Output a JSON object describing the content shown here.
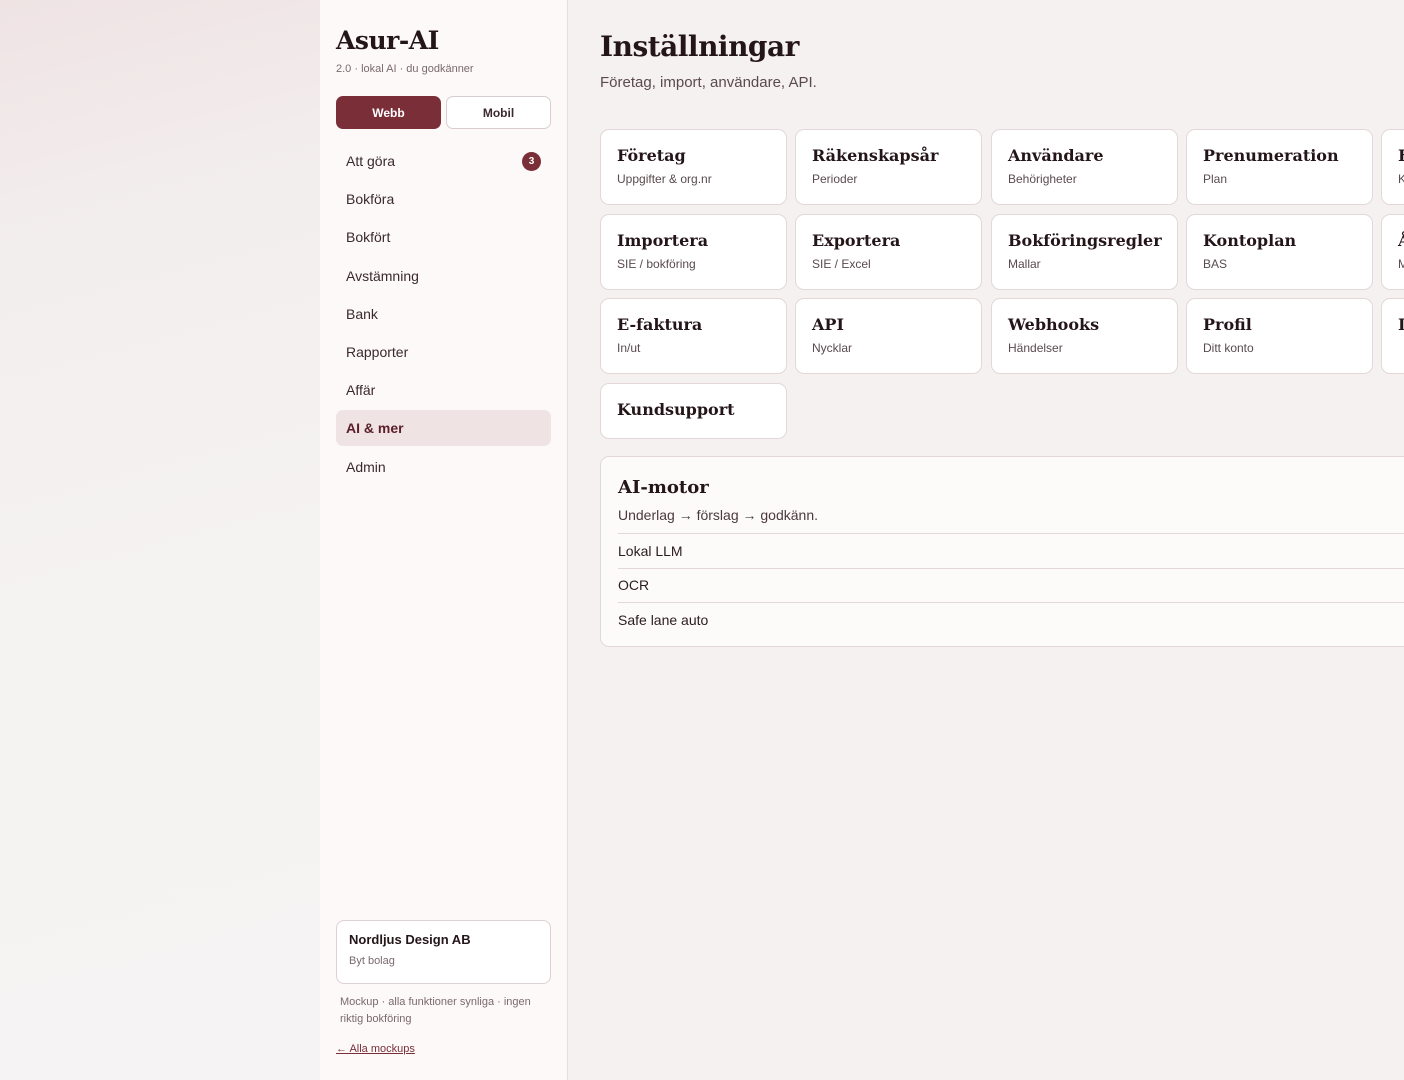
{
  "app": {
    "name": "Asur-AI",
    "tagline": "2.0 · lokal AI · du godkänner"
  },
  "view_toggle": {
    "web_label": "Webb",
    "mobile_label": "Mobil",
    "selected": "Webb"
  },
  "nav": {
    "items": [
      {
        "label": "Att göra",
        "badge": "3"
      },
      {
        "label": "Bokföra"
      },
      {
        "label": "Bokfört"
      },
      {
        "label": "Avstämning"
      },
      {
        "label": "Bank"
      },
      {
        "label": "Rapporter"
      },
      {
        "label": "Affär"
      },
      {
        "label": "AI & mer",
        "active": true
      },
      {
        "label": "Admin"
      }
    ]
  },
  "company": {
    "name": "Nordljus Design AB",
    "switch_label": "Byt bolag"
  },
  "footer": {
    "note": "Mockup · alla funktioner synliga · ingen riktig bokföring",
    "back_link": "← Alla mockups"
  },
  "page": {
    "title": "Inställningar",
    "subtitle": "Företag, import, användare, API."
  },
  "tiles": [
    {
      "title": "Företag",
      "sub": "Uppgifter & org.nr"
    },
    {
      "title": "Räkenskapsår",
      "sub": "Perioder"
    },
    {
      "title": "Användare",
      "sub": "Behörigheter"
    },
    {
      "title": "Prenumeration",
      "sub": "Plan"
    },
    {
      "title": "F",
      "sub": "K"
    },
    {
      "title": "Importera",
      "sub": "SIE / bokföring"
    },
    {
      "title": "Exportera",
      "sub": "SIE / Excel"
    },
    {
      "title": "Bokföringsregler",
      "sub": "Mallar"
    },
    {
      "title": "Kontoplan",
      "sub": "BAS"
    },
    {
      "title": "Å",
      "sub": "M"
    },
    {
      "title": "E-faktura",
      "sub": "In/ut"
    },
    {
      "title": "API",
      "sub": "Nycklar"
    },
    {
      "title": "Webhooks",
      "sub": "Händelser"
    },
    {
      "title": "Profil",
      "sub": "Ditt konto"
    },
    {
      "title": "I",
      "sub": ""
    },
    {
      "title": "Kundsupport",
      "sub": ""
    }
  ],
  "ai_engine": {
    "title": "AI-motor",
    "subtitle": "Underlag → förslag → godkänn.",
    "rows": [
      "Lokal LLM",
      "OCR",
      "Safe lane auto"
    ]
  },
  "colors": {
    "accent": "#7a2e38",
    "sidebar_bg": "#fdf9f9",
    "page_bg": "#f5f1f1",
    "active_nav_bg": "#f0e3e4"
  }
}
